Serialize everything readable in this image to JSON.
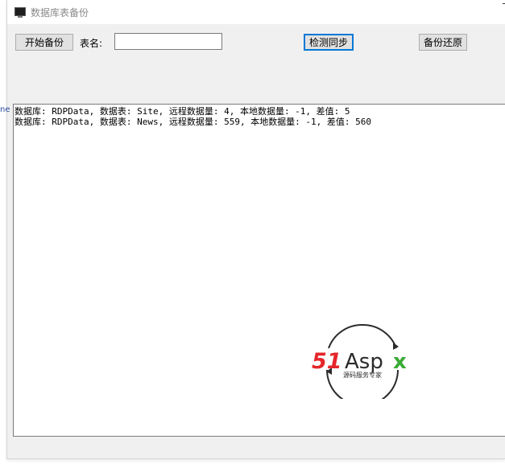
{
  "window": {
    "title": "数据库表备份"
  },
  "toolbar": {
    "start_backup_label": "开始备份",
    "table_name_label": "表名:",
    "table_name_value": "",
    "check_sync_label": "检测同步",
    "backup_restore_label": "备份还原"
  },
  "log": {
    "lines": [
      "数据库: RDPData, 数据表: Site, 远程数据量: 4, 本地数据量: -1, 差值: 5",
      "数据库: RDPData, 数据表: News, 远程数据量: 559, 本地数据量: -1, 差值: 560"
    ]
  },
  "edge_fragment": "ne",
  "watermark": {
    "brand": "51Aspx",
    "tagline": "源码服务专家"
  },
  "colors": {
    "brand_red": "#e4262a",
    "brand_green": "#3aaa35",
    "brand_dark": "#2b2b2b",
    "focus_blue": "#0078d7"
  }
}
